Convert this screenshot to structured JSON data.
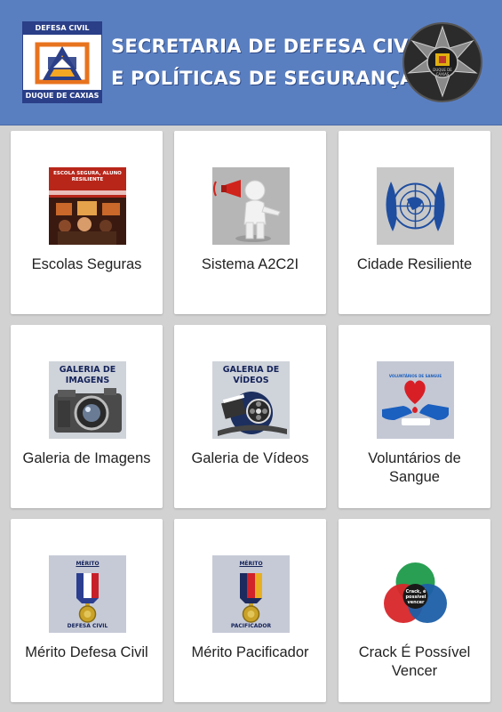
{
  "header": {
    "title_line1": "SECRETARIA DE DEFESA CIVIL",
    "title_line2": "E POLÍTICAS DE SEGURANÇA",
    "logo_left_top": "DEFESA CIVIL",
    "logo_left_bottom": "DUQUE DE CAXIAS",
    "logo_right_text": "DUQUE DE CAXIAS"
  },
  "tiles": [
    {
      "label": "Escolas Seguras",
      "icon": "school-icon",
      "icon_caption": "ESCOLA SEGURA, ALUNO RESILIENTE"
    },
    {
      "label": "Sistema A2C2I",
      "icon": "megaphone-person-icon"
    },
    {
      "label": "Cidade Resiliente",
      "icon": "un-emblem-icon"
    },
    {
      "label": "Galeria de Imagens",
      "icon": "camera-icon",
      "icon_caption": "GALERIA DE IMAGENS"
    },
    {
      "label": "Galeria de Vídeos",
      "icon": "film-reel-icon",
      "icon_caption": "GALERIA DE VÍDEOS"
    },
    {
      "label": "Voluntários de Sangue",
      "icon": "blood-heart-icon",
      "icon_caption": "VOLUNTÁRIOS DE SANGUE"
    },
    {
      "label": "Mérito Defesa Civil",
      "icon": "medal-icon",
      "icon_caption_top": "MÉRITO",
      "icon_caption_bottom": "DEFESA CIVIL"
    },
    {
      "label": "Mérito Pacificador",
      "icon": "medal-icon",
      "icon_caption_top": "MÉRITO",
      "icon_caption_bottom": "PACIFICADOR"
    },
    {
      "label": "Crack É Possível Vencer",
      "icon": "venn-circles-icon",
      "icon_caption": "Crack, é possível vencer"
    }
  ],
  "colors": {
    "header_bg": "#5a7fc1",
    "page_bg": "#d2d2d2",
    "tile_bg": "#ffffff",
    "icon_bg": "#b3b3b3"
  }
}
